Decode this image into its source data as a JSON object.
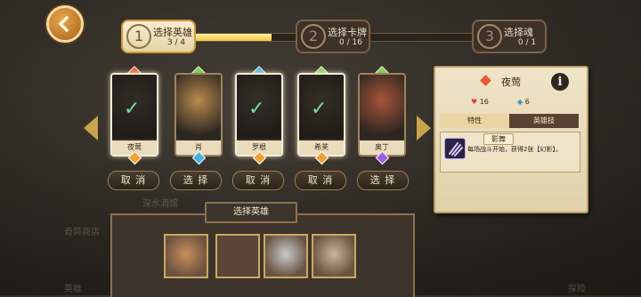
{
  "steps": [
    {
      "num": "1",
      "title": "选择英雄",
      "count": "3 / 4"
    },
    {
      "num": "2",
      "title": "选择卡牌",
      "count": "0 / 16"
    },
    {
      "num": "3",
      "title": "选择魂",
      "count": "0 / 1"
    }
  ],
  "progress_fraction": 0.28,
  "heroes": [
    {
      "name": "夜莺",
      "state": "selected",
      "button": "取 消",
      "gem_color": "#e85a36",
      "face_color": "#4e4138"
    },
    {
      "name": "肖",
      "state": "available",
      "button": "选 择",
      "gem_color": "#7fcf5a",
      "face_color": "#b98a4e"
    },
    {
      "name": "罗根",
      "state": "selected",
      "button": "取 消",
      "gem_color": "#4ab0e0",
      "face_color": "#51473c"
    },
    {
      "name": "希芙",
      "state": "selected",
      "button": "取 消",
      "gem_color": "#7fcf5a",
      "face_color": "#4f4535"
    },
    {
      "name": "奥丁",
      "state": "available",
      "button": "选 择",
      "gem_color": "#7fcf5a",
      "face_color": "#a8543a"
    }
  ],
  "panel": {
    "hero_name": "夜莺",
    "info_icon": "i",
    "stat_hp": "16",
    "stat_def": "6",
    "tab_trait": "特性",
    "tab_skill": "英雄技",
    "skill_name": "影舞",
    "skill_desc": "每场战斗开始，获得2张【幻影】。"
  },
  "tray": {
    "title": "选择英雄",
    "slots": [
      {
        "filled": true,
        "color": "#c98f5a"
      },
      {
        "filled": false,
        "color": "#5a4538"
      },
      {
        "filled": true,
        "color": "#c8ccd0"
      },
      {
        "filled": true,
        "color": "#c7b89a"
      }
    ]
  },
  "background_labels": [
    "深水酒馆",
    "奇异商店",
    "英雄",
    "探险"
  ],
  "colors": {
    "accent": "#c9a24e",
    "progress": "#f2c746",
    "check": "#6fe09b"
  }
}
